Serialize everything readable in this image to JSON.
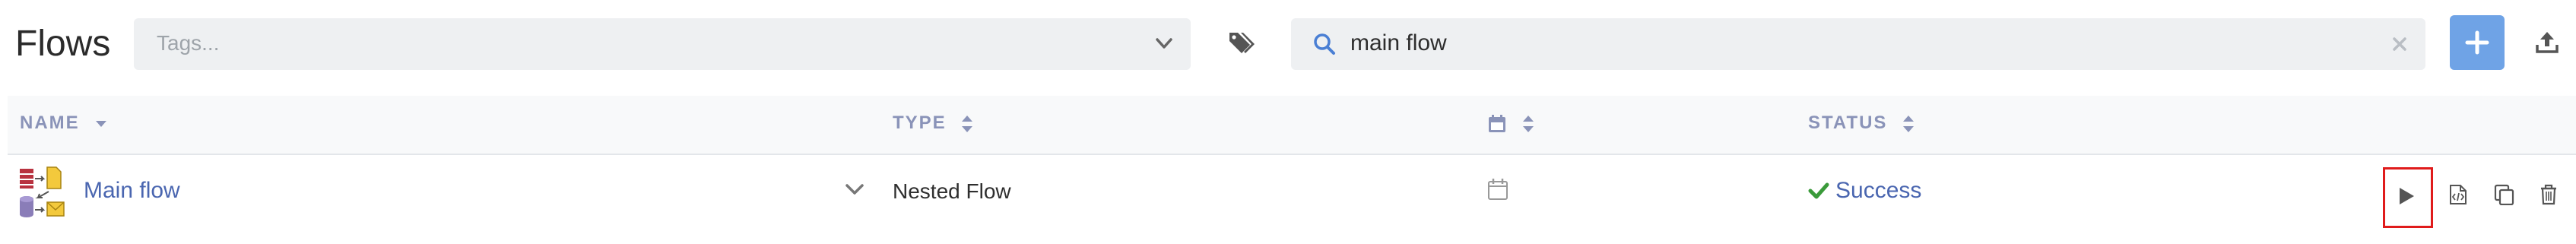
{
  "header": {
    "title": "Flows",
    "tags_placeholder": "Tags...",
    "search_value": "main flow"
  },
  "table": {
    "columns": {
      "name": "NAME",
      "type": "TYPE",
      "status": "STATUS"
    },
    "rows": [
      {
        "name": "Main flow",
        "type": "Nested Flow",
        "status": "Success"
      }
    ]
  },
  "colors": {
    "accent": "#6fa3e6",
    "link": "#4a66b0",
    "success": "#3a9a3a",
    "highlight": "#e01b1b",
    "header_text": "#8a93b8"
  },
  "icons": {
    "tags": "tags-icon",
    "search": "search-icon",
    "clear": "close-icon",
    "add": "plus-icon",
    "upload": "upload-icon",
    "calendar": "calendar-icon",
    "run": "play-icon",
    "source": "code-file-icon",
    "duplicate": "copy-icon",
    "delete": "trash-icon"
  }
}
